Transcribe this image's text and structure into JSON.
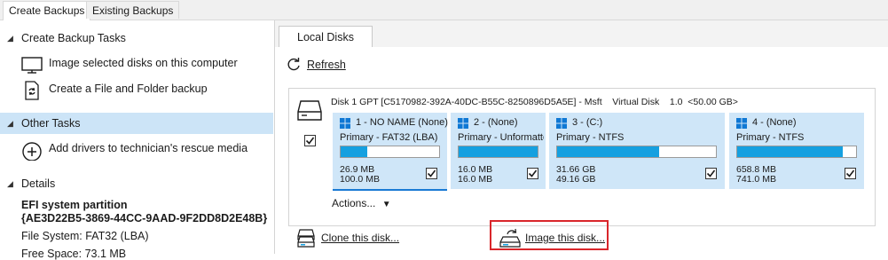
{
  "top_tabs": [
    "Create Backups",
    "Existing Backups"
  ],
  "left": {
    "create_backup_tasks": {
      "title": "Create Backup Tasks",
      "items": [
        "Image selected disks on this computer",
        "Create a File and Folder backup"
      ]
    },
    "other_tasks": {
      "title": "Other Tasks",
      "items": [
        "Add drivers to technician's rescue media"
      ]
    },
    "details": {
      "title": "Details",
      "name": "EFI system partition",
      "guid": "{AE3D22B5-3869-44CC-9AAD-9F2DD8D2E48B}",
      "file_system": "File System: FAT32 (LBA)",
      "partial_line": "Free Space: 73.1 MB"
    }
  },
  "right": {
    "tab": "Local Disks",
    "refresh_label": "Refresh",
    "disk": {
      "header": "Disk 1 GPT [C5170982-392A-40DC-B55C-8250896D5A5E] - Msft    Virtual Disk    1.0  <50.00 GB>",
      "checked": true,
      "partitions": [
        {
          "title": "1 - NO NAME (None)",
          "type": "Primary - FAT32 (LBA)",
          "used": "26.9 MB",
          "total": "100.0 MB",
          "fill": 0.27,
          "checked": true
        },
        {
          "title": "2 -  (None)",
          "type": "Primary - Unformatted",
          "used": "16.0 MB",
          "total": "16.0 MB",
          "fill": 1.0,
          "checked": true
        },
        {
          "title": "3 -  (C:)",
          "type": "Primary - NTFS",
          "used": "31.66 GB",
          "total": "49.16 GB",
          "fill": 0.64,
          "checked": true
        },
        {
          "title": "4 -  (None)",
          "type": "Primary - NTFS",
          "used": "658.8 MB",
          "total": "741.0 MB",
          "fill": 0.89,
          "checked": true
        }
      ],
      "actions_label": "Actions..."
    },
    "clone_label": "Clone this disk...",
    "image_label": "Image this disk..."
  }
}
